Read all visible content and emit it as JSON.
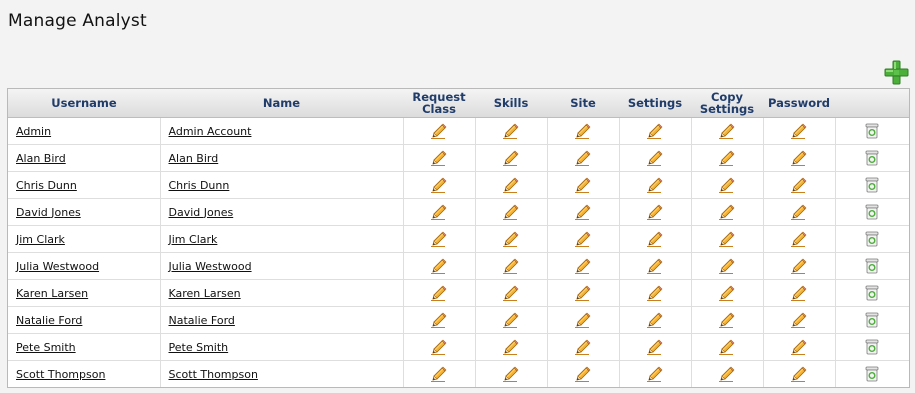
{
  "page": {
    "title": "Manage Analyst"
  },
  "toolbar": {
    "add_icon": "plus-icon"
  },
  "table": {
    "headers": {
      "username": "Username",
      "name": "Name",
      "request_class": "Request\nClass",
      "skills": "Skills",
      "site": "Site",
      "settings": "Settings",
      "copy_settings": "Copy\nSettings",
      "password": "Password",
      "delete": ""
    },
    "rows": [
      {
        "username": "Admin",
        "name": "Admin Account"
      },
      {
        "username": "Alan Bird",
        "name": "Alan Bird"
      },
      {
        "username": "Chris Dunn",
        "name": "Chris Dunn"
      },
      {
        "username": "David Jones",
        "name": "David Jones"
      },
      {
        "username": "Jim Clark",
        "name": "Jim Clark"
      },
      {
        "username": "Julia Westwood",
        "name": "Julia Westwood"
      },
      {
        "username": "Karen Larsen",
        "name": "Karen Larsen"
      },
      {
        "username": "Natalie Ford",
        "name": "Natalie Ford"
      },
      {
        "username": "Pete Smith",
        "name": "Pete Smith"
      },
      {
        "username": "Scott Thompson",
        "name": "Scott Thompson"
      }
    ],
    "edit_icon": "pencil-icon",
    "delete_icon": "recycle-bin-icon"
  },
  "colors": {
    "header_text": "#1f3c6b",
    "add_green": "#4caf3a",
    "pencil": "#f0a21a",
    "background": "#f3f3f3"
  }
}
